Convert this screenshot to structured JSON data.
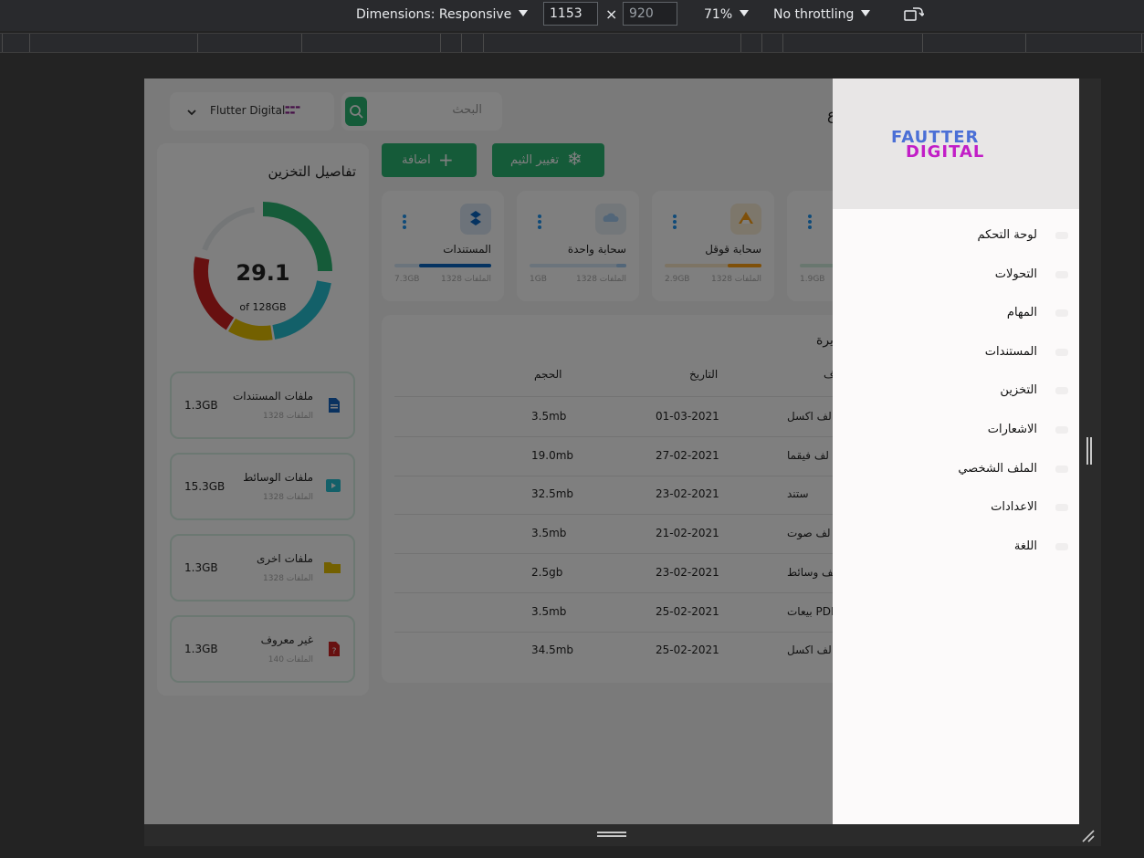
{
  "devtools": {
    "dimensions_label": "Dimensions: Responsive",
    "width_value": "1153",
    "height_value": "920",
    "zoom_label": "71%",
    "throttling_label": "No throttling",
    "rotate_icon": "rotate-icon"
  },
  "app": {
    "search_placeholder": "البحث",
    "profile_name": "Flutter Digital",
    "header_title_fragment": "ع",
    "buttons": {
      "add_label": "اضافة",
      "theme_label": "تغيير الثيم"
    },
    "storage_tiles": [
      {
        "title": "المستندات",
        "files": "1328 الملفات",
        "size": "7.3GB",
        "icon": "dropbox-icon",
        "color": "#0a66c2",
        "progress": 0.75
      },
      {
        "title": "سحابة واحدة",
        "files": "1328 الملفات",
        "size": "1GB",
        "icon": "cloud-icon",
        "color": "#a4cdf3",
        "progress": 0.1
      },
      {
        "title": "سحابة قوقل",
        "files": "1328 الملفات",
        "size": "2.9GB",
        "icon": "google-drive-icon",
        "color": "#ffa113",
        "progress": 0.35
      },
      {
        "title": "",
        "files": "",
        "size": "1.9GB",
        "icon": "",
        "color": "#2bb673",
        "progress": 0.3
      }
    ],
    "recent_files": {
      "title_fragment": "يرة",
      "columns": [
        "ف",
        "التاريخ",
        "الحجم"
      ],
      "rows": [
        {
          "name": "لف اكسل",
          "date": "01-03-2021",
          "size": "3.5mb"
        },
        {
          "name": "لف فيقما",
          "date": "27-02-2021",
          "size": "19.0mb"
        },
        {
          "name": "ستند",
          "date": "23-02-2021",
          "size": "32.5mb"
        },
        {
          "name": "لف صوت",
          "date": "21-02-2021",
          "size": "3.5mb"
        },
        {
          "name": "لف وسائط",
          "date": "23-02-2021",
          "size": "2.5gb"
        },
        {
          "name": "بيعات PDF",
          "date": "25-02-2021",
          "size": "3.5mb"
        },
        {
          "name": "لف اكسل",
          "date": "25-02-2021",
          "size": "34.5mb"
        }
      ]
    },
    "storage_details": {
      "title": "تفاصيل التخزين",
      "used": "29.1",
      "total": "of 128GB",
      "chart_colors": [
        "#2bb673",
        "#26c0d3",
        "#e7c100",
        "#ce2121",
        "#e8ecef"
      ],
      "items": [
        {
          "title": "ملفات المستندات",
          "files": "1328 الملفات",
          "size": "1.3GB",
          "icon": "document-icon",
          "color": "#1565c0"
        },
        {
          "title": "ملفات الوسائط",
          "files": "1328 الملفات",
          "size": "15.3GB",
          "icon": "media-icon",
          "color": "#26c0d3"
        },
        {
          "title": "ملفات اخرى",
          "files": "1328 الملفات",
          "size": "1.3GB",
          "icon": "folder-icon",
          "color": "#e7c100"
        },
        {
          "title": "غير معروف",
          "files": "140 الملفات",
          "size": "1.3GB",
          "icon": "unknown-file-icon",
          "color": "#ce2121"
        }
      ]
    }
  },
  "drawer": {
    "logo_line1": "FAUTTER",
    "logo_line2": "DIGITAL",
    "items": [
      "لوحة التحكم",
      "التحولات",
      "المهام",
      "المستندات",
      "التخزين",
      "الاشعارات",
      "الملف الشخصي",
      "الاعدادات",
      "اللغة"
    ]
  }
}
